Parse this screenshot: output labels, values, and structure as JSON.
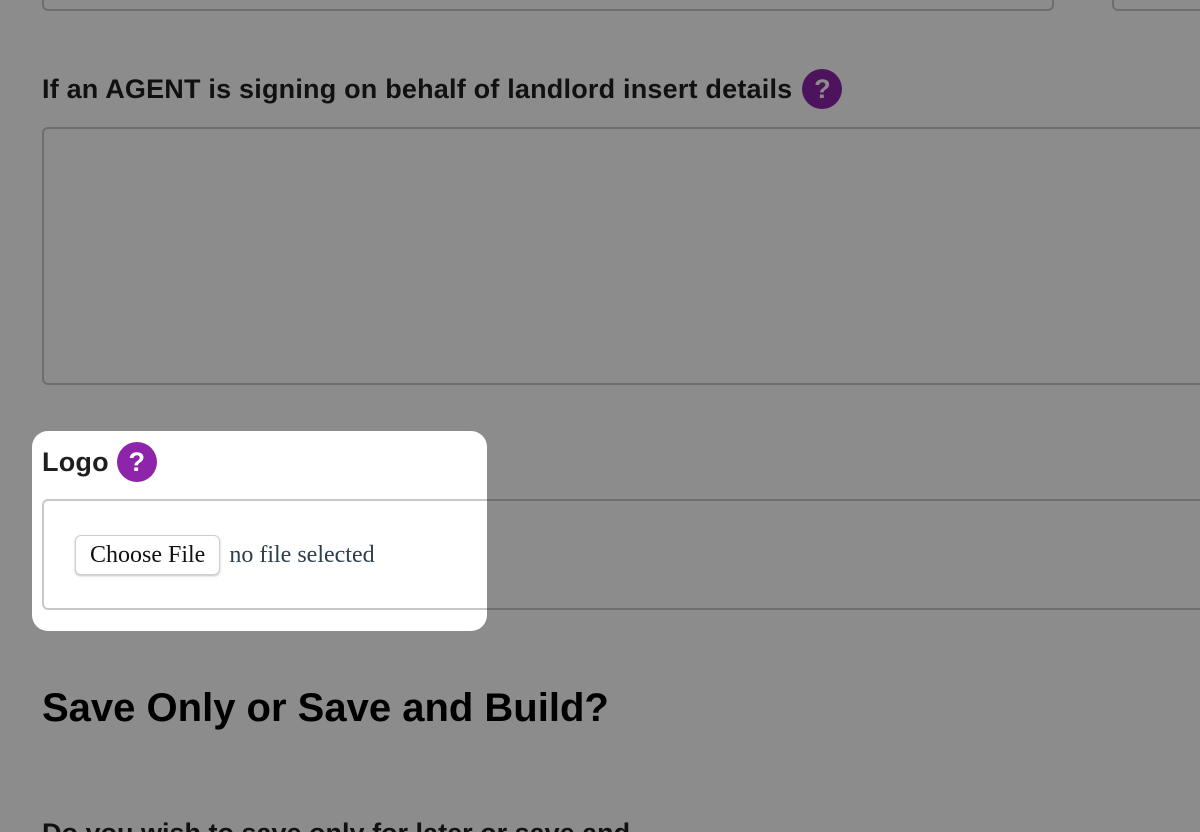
{
  "agent_section": {
    "label": "If an AGENT is signing on behalf of landlord insert details",
    "help_icon": "?",
    "textarea_value": ""
  },
  "logo_section": {
    "label": "Logo",
    "help_icon": "?",
    "choose_file_label": "Choose File",
    "file_status": "no file selected"
  },
  "save_section": {
    "heading": "Save Only or Save and Build?",
    "question_partial": "Do you wish to save only for later or save and"
  },
  "colors": {
    "help_icon_bg": "#8e24aa",
    "overlay": "rgba(0,0,0,0.45)"
  },
  "icons": {
    "help": "question-mark-circle-icon"
  }
}
